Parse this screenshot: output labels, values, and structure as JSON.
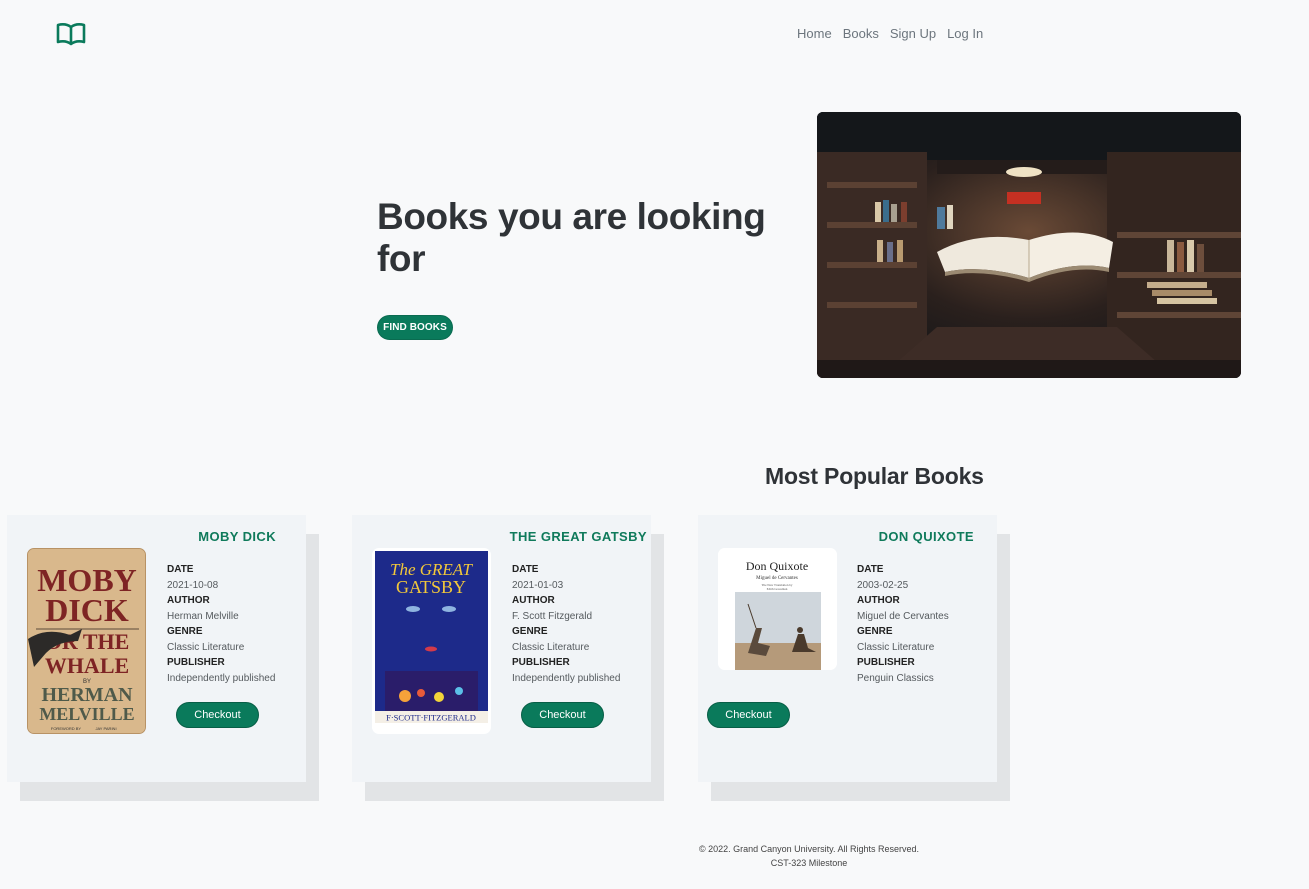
{
  "nav": {
    "logo_icon": "open-book-icon",
    "items": [
      "Home",
      "Books",
      "Sign Up",
      "Log In"
    ]
  },
  "hero": {
    "title": "Books you are looking for",
    "button": "FIND BOOKS",
    "image": "library-floating-book-photo"
  },
  "popular": {
    "title": "Most Popular Books",
    "labels": {
      "date": "DATE",
      "author": "AUTHOR",
      "genre": "GENRE",
      "publisher": "PUBLISHER"
    },
    "books": [
      {
        "title": "MOBY DICK",
        "cover_text": [
          "MOBY",
          "DICK",
          "OR THE",
          "WHALE",
          "BY",
          "HERMAN",
          "MELVILLE",
          "FOREWORD BY",
          "JAY PARINI"
        ],
        "date": "2021-10-08",
        "author": "Herman Melville",
        "genre": "Classic Literature",
        "publisher": "Independently published",
        "checkout": "Checkout"
      },
      {
        "title": "THE GREAT GATSBY",
        "cover_text": [
          "The GREAT",
          "GATSBY",
          "F·SCOTT·FITZGERALD"
        ],
        "date": "2021-01-03",
        "author": "F. Scott Fitzgerald",
        "genre": "Classic Literature",
        "publisher": "Independently published",
        "checkout": "Checkout"
      },
      {
        "title": "DON QUIXOTE",
        "cover_text": [
          "Don Quixote",
          "Miguel de Cervantes",
          "The New Translation by",
          "Edith Grossman"
        ],
        "date": "2003-02-25",
        "author": "Miguel de Cervantes",
        "genre": "Classic Literature",
        "publisher": "Penguin Classics",
        "checkout": "Checkout"
      }
    ]
  },
  "footer": {
    "line1": "© 2022. Grand Canyon University. All Rights Reserved.",
    "line2": "CST-323 Milestone"
  },
  "colors": {
    "accent": "#0a7a5b",
    "title_green": "#0f7a5b",
    "background": "#f8f9fa",
    "card": "#f1f4f7"
  }
}
